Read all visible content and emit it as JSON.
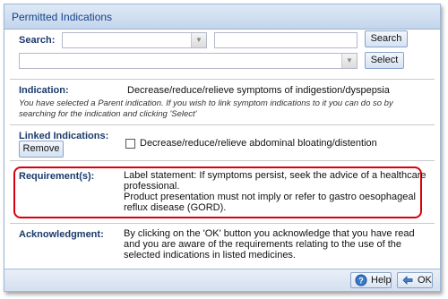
{
  "dialog": {
    "title": "Permitted Indications"
  },
  "search": {
    "label": "Search:",
    "parent_value": "",
    "text_value": "",
    "search_button": "Search",
    "select_value": "",
    "select_button": "Select"
  },
  "indication": {
    "label": "Indication:",
    "value": "Decrease/reduce/relieve symptoms of indigestion/dyspepsia",
    "hint": "You have selected a Parent indication. If you wish to link symptom indications to it you can do so by searching for the indication and clicking 'Select'"
  },
  "linked": {
    "label": "Linked Indications:",
    "remove_button": "Remove",
    "items": [
      {
        "label": "Decrease/reduce/relieve abdominal bloating/distention",
        "checked": false
      }
    ]
  },
  "requirements": {
    "label": "Requirement(s):",
    "line1": "Label statement: If symptoms persist, seek the advice of a healthcare",
    "line2": "professional.",
    "line3": "Product presentation must not imply or refer to gastro oesophageal",
    "line4": "reflux disease (GORD)."
  },
  "acknowledgment": {
    "label": "Acknowledgment:",
    "line1": "By clicking on the 'OK' button you acknowledge that you have read",
    "line2": "and you are aware of the requirements relating to the use of the",
    "line3": "selected indications in listed medicines."
  },
  "footer": {
    "help_button": "Help",
    "ok_button": "OK"
  },
  "colors": {
    "highlight_border": "#d9000d",
    "title_text": "#15428b",
    "label_text": "#1b3a6b"
  },
  "icons": {
    "help": "help-icon",
    "ok": "ok-icon",
    "dropdown": "chevron-down-icon"
  }
}
